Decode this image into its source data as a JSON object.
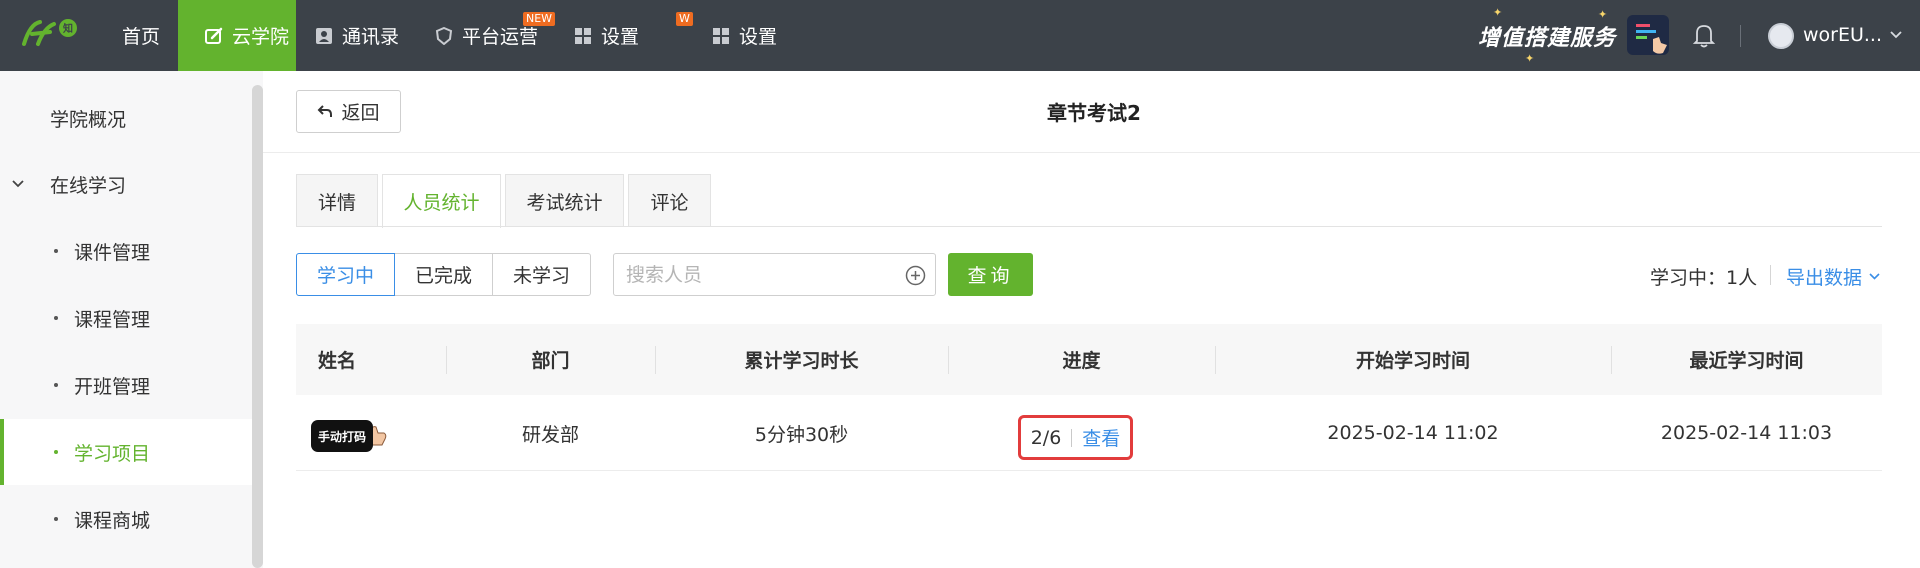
{
  "nav": {
    "items": [
      {
        "label": "首页"
      },
      {
        "label": "云学院"
      },
      {
        "label": "通讯录"
      },
      {
        "label": "平台运营",
        "badge": "NEW"
      },
      {
        "label": "设置"
      },
      {
        "label": "设置",
        "badge": "W"
      }
    ],
    "value_added": "增值搭建服务",
    "user_name": "worEU..."
  },
  "sidebar": {
    "items": [
      {
        "label": "学院概况"
      },
      {
        "label": "在线学习"
      },
      {
        "label": "课件管理"
      },
      {
        "label": "课程管理"
      },
      {
        "label": "开班管理"
      },
      {
        "label": "学习项目"
      },
      {
        "label": "课程商城"
      }
    ],
    "active_index": 5
  },
  "header": {
    "back_label": "返回",
    "title": "章节考试2"
  },
  "tabs": [
    {
      "label": "详情"
    },
    {
      "label": "人员统计"
    },
    {
      "label": "考试统计"
    },
    {
      "label": "评论"
    }
  ],
  "filters": {
    "segments": [
      {
        "label": "学习中"
      },
      {
        "label": "已完成"
      },
      {
        "label": "未学习"
      }
    ],
    "search_placeholder": "搜索人员",
    "query_label": "查询",
    "study_count": "学习中：1人",
    "export_label": "导出数据"
  },
  "table": {
    "headers": [
      "姓名",
      "部门",
      "累计学习时长",
      "进度",
      "开始学习时间",
      "最近学习时间"
    ],
    "rows": [
      {
        "name_tag": "手动打码",
        "department": "研发部",
        "duration": "5分钟30秒",
        "progress": "2/6",
        "view_label": "查看",
        "start_time": "2025-02-14 11:02",
        "last_time": "2025-02-14 11:03"
      }
    ]
  },
  "colors": {
    "accent_green": "#63b32e",
    "link_blue": "#3a8ee6",
    "highlight_red": "#e23c3c",
    "topbar": "#3c4249"
  }
}
